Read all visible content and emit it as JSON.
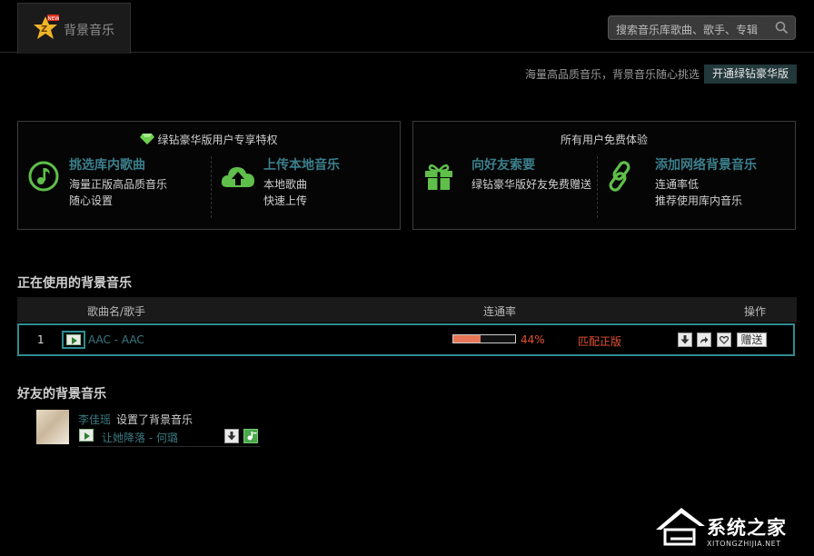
{
  "header": {
    "tab_label": "背景音乐",
    "logo_badge": "NEW",
    "search_placeholder": "搜索音乐库歌曲、歌手、专辑"
  },
  "promo": {
    "text": "海量高品质音乐，背景音乐随心挑选",
    "button": "开通绿钻豪华版"
  },
  "vip_panel": {
    "title": "绿钻豪华版用户专享特权",
    "features": [
      {
        "title": "挑选库内歌曲",
        "line1": "海量正版高品质音乐",
        "line2": "随心设置",
        "icon": "music-note-icon"
      },
      {
        "title": "上传本地音乐",
        "line1": "本地歌曲",
        "line2": "快速上传",
        "icon": "cloud-upload-icon"
      }
    ]
  },
  "free_panel": {
    "title": "所有用户免费体验",
    "features": [
      {
        "title": "向好友索要",
        "line1": "绿钻豪华版好友免费赠送",
        "line2": "",
        "icon": "gift-icon"
      },
      {
        "title": "添加网络背景音乐",
        "line1": "连通率低",
        "line2": "推荐使用库内音乐",
        "icon": "link-icon"
      }
    ]
  },
  "current": {
    "section_title": "正在使用的背景音乐",
    "columns": {
      "song": "歌曲名/歌手",
      "rate": "连通率",
      "ops": "操作"
    },
    "row": {
      "index": "1",
      "song": "AAC - AAC",
      "rate_percent": 44,
      "rate_label": "44%",
      "match": "匹配正版",
      "gift_button": "赠送"
    }
  },
  "friends": {
    "section_title": "好友的背景音乐",
    "items": [
      {
        "name": "李佳瑶",
        "action": "设置了背景音乐",
        "song": "让她降落 - 何璐"
      }
    ]
  },
  "watermark": {
    "text": "系统之家",
    "url": "XITONGZHIJIA.NET"
  },
  "colors": {
    "accent_green": "#5fbf4a",
    "link_teal": "#3b7880",
    "highlight_border": "#2f8c8f",
    "alert_red": "#e5512f"
  }
}
